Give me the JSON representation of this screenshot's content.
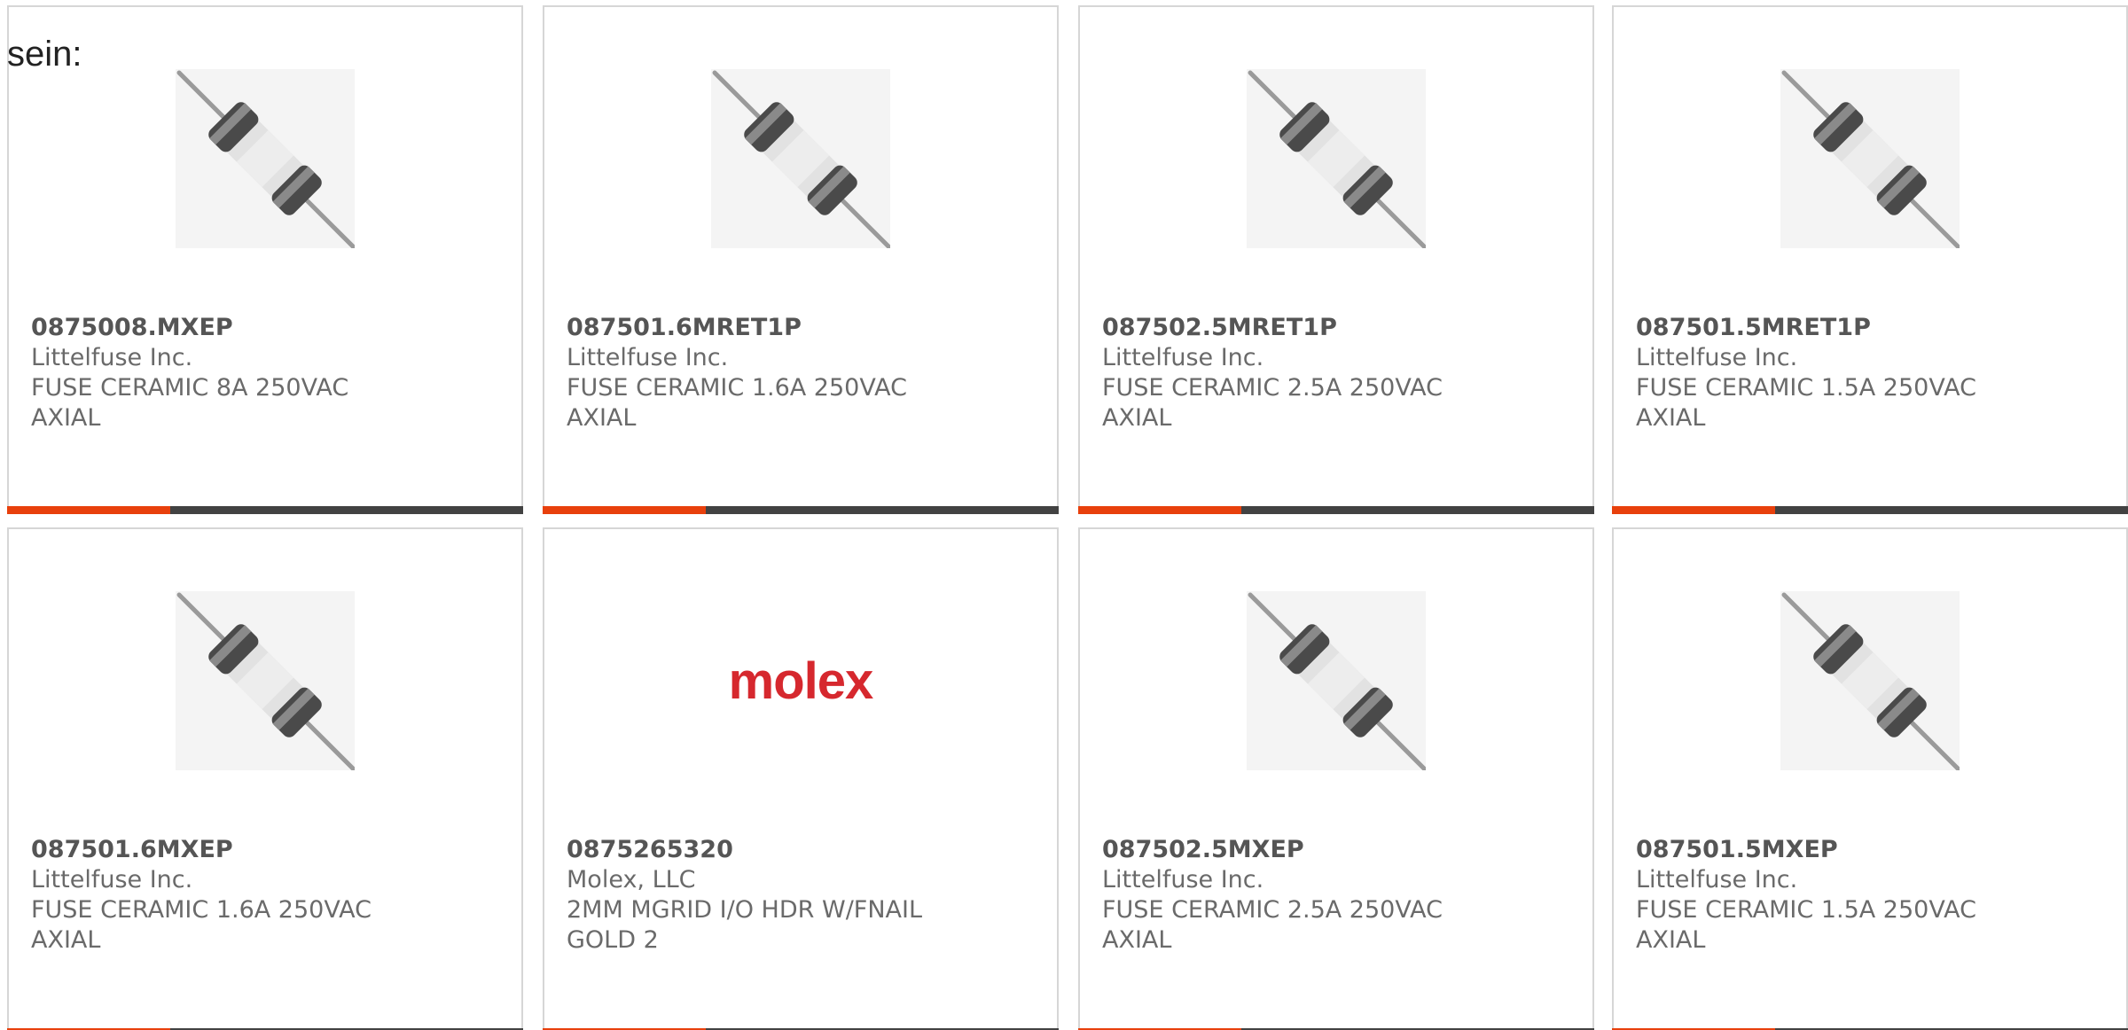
{
  "intro_text": "sein:",
  "colors": {
    "accent": "#e8400c",
    "bar": "#424242",
    "border": "#d6d6d6",
    "molex_red": "#d6282e"
  },
  "products": [
    {
      "part_number": "0875008.MXEP",
      "manufacturer": "Littelfuse Inc.",
      "description": "FUSE CERAMIC 8A 250VAC AXIAL",
      "image": "fuse-image"
    },
    {
      "part_number": "087501.6MRET1P",
      "manufacturer": "Littelfuse Inc.",
      "description": "FUSE CERAMIC 1.6A 250VAC AXIAL",
      "image": "fuse-image"
    },
    {
      "part_number": "087502.5MRET1P",
      "manufacturer": "Littelfuse Inc.",
      "description": "FUSE CERAMIC 2.5A 250VAC AXIAL",
      "image": "fuse-image"
    },
    {
      "part_number": "087501.5MRET1P",
      "manufacturer": "Littelfuse Inc.",
      "description": "FUSE CERAMIC 1.5A 250VAC AXIAL",
      "image": "fuse-image"
    },
    {
      "part_number": "087501.6MXEP",
      "manufacturer": "Littelfuse Inc.",
      "description": "FUSE CERAMIC 1.6A 250VAC AXIAL",
      "image": "fuse-image"
    },
    {
      "part_number": "0875265320",
      "manufacturer": "Molex, LLC",
      "description": "2MM MGRID I/O HDR W/FNAIL GOLD 2",
      "image": "molex-logo",
      "logo_text": "molex"
    },
    {
      "part_number": "087502.5MXEP",
      "manufacturer": "Littelfuse Inc.",
      "description": "FUSE CERAMIC 2.5A 250VAC AXIAL",
      "image": "fuse-image"
    },
    {
      "part_number": "087501.5MXEP",
      "manufacturer": "Littelfuse Inc.",
      "description": "FUSE CERAMIC 1.5A 250VAC AXIAL",
      "image": "fuse-image"
    }
  ]
}
